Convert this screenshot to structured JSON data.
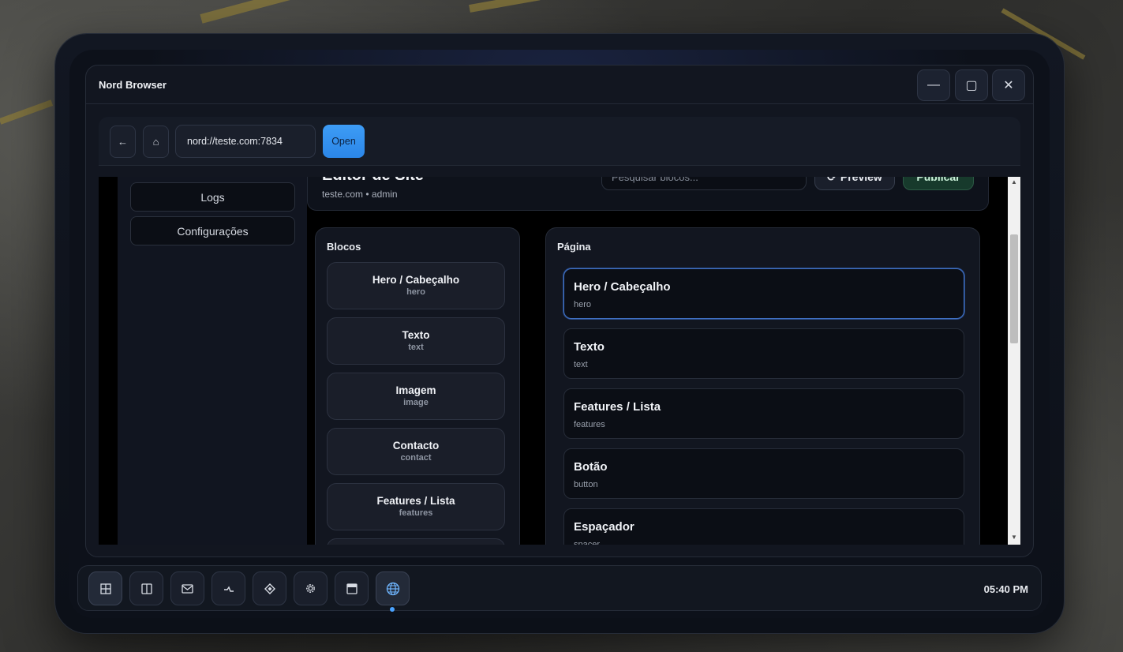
{
  "window": {
    "title": "Nord Browser",
    "controls": {
      "minimize": "—",
      "maximize": "▢",
      "close": "✕"
    }
  },
  "browser": {
    "back": "←",
    "home": "⌂",
    "url": "nord://teste.com:7834",
    "open_label": "Open"
  },
  "sidebar": {
    "items": [
      {
        "label": "Logs"
      },
      {
        "label": "Configurações"
      }
    ]
  },
  "header": {
    "title": "Editor de Site",
    "subtitle": "teste.com • admin",
    "search_placeholder": "Pesquisar blocos...",
    "preview_icon": "⟳",
    "preview_label": "Preview",
    "publish_label": "Publicar"
  },
  "blocks_panel": {
    "title": "Blocos",
    "items": [
      {
        "name": "Hero / Cabeçalho",
        "slug": "hero"
      },
      {
        "name": "Texto",
        "slug": "text"
      },
      {
        "name": "Imagem",
        "slug": "image"
      },
      {
        "name": "Contacto",
        "slug": "contact"
      },
      {
        "name": "Features / Lista",
        "slug": "features"
      }
    ]
  },
  "page_panel": {
    "title": "Página",
    "items": [
      {
        "name": "Hero / Cabeçalho",
        "slug": "hero"
      },
      {
        "name": "Texto",
        "slug": "text"
      },
      {
        "name": "Features / Lista",
        "slug": "features"
      },
      {
        "name": "Botão",
        "slug": "button"
      },
      {
        "name": "Espaçador",
        "slug": "spacer"
      }
    ]
  },
  "taskbar": {
    "icons": [
      "grid-icon",
      "split-view-icon",
      "mail-icon",
      "activity-icon",
      "diamond-icon",
      "gear-icon",
      "window-icon",
      "globe-icon"
    ],
    "clock": "05:40 PM"
  },
  "colors": {
    "accent": "#3d9cf5",
    "publish": "#173a2c",
    "selected_border": "#3f6fc0"
  }
}
